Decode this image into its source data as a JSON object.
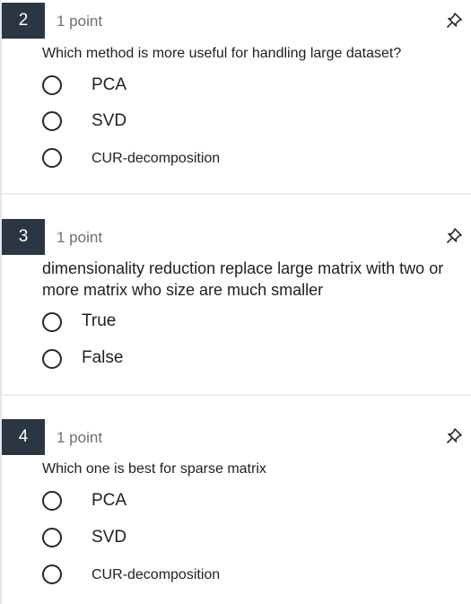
{
  "questions": [
    {
      "number": "2",
      "points": "1 point",
      "text": "Which method is more useful for handling large dataset?",
      "options": [
        "PCA",
        "SVD",
        "CUR-decomposition"
      ]
    },
    {
      "number": "3",
      "points": "1 point",
      "text_line1": "dimensionality reduction replace large matrix with two or",
      "text_line2": "more matrix who size are much smaller",
      "options": [
        "True",
        "False"
      ]
    },
    {
      "number": "4",
      "points": "1 point",
      "text": "Which one is best for sparse matrix",
      "options": [
        "PCA",
        "SVD",
        "CUR-decomposition"
      ]
    }
  ],
  "icons": {
    "pin": "pin-icon",
    "radio": "radio-button"
  }
}
